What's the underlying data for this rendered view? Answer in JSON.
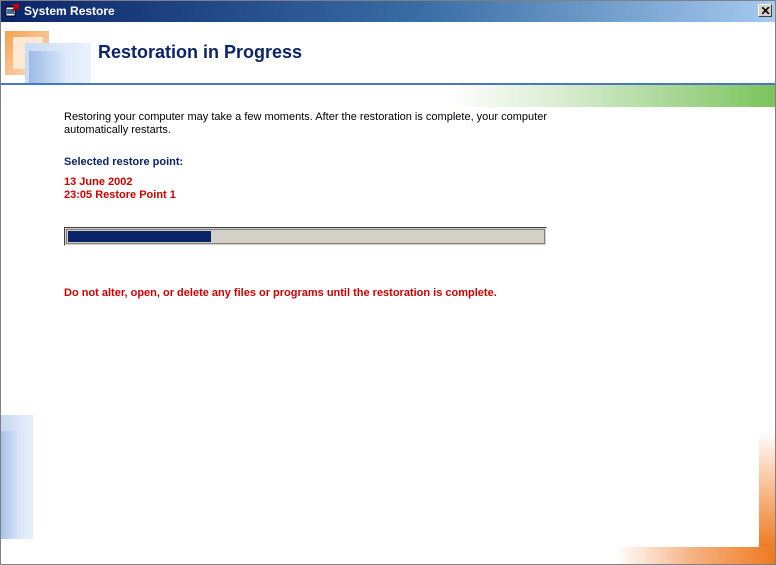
{
  "window": {
    "title": "System Restore",
    "icons": {
      "app": "system-restore-icon",
      "close": "close-icon"
    }
  },
  "header": {
    "title": "Restoration in Progress",
    "colors": {
      "title": "#0a246a",
      "rule": "#4a78c0",
      "accent_strip": "#7bc45c"
    }
  },
  "body": {
    "intro": "Restoring your computer may take a few moments. After the restoration is complete, your computer automatically restarts.",
    "selected_label": "Selected restore point:",
    "restore_point_date": "13 June 2002",
    "restore_point_name": "23:05 Restore Point 1",
    "progress_fraction": 0.3,
    "warning": "Do not alter, open, or delete any files or programs until the restoration is complete.",
    "colors": {
      "label": "#0a246a",
      "restore_point": "#d40000",
      "warning": "#d40000",
      "progress_fill": "#0a246a"
    }
  }
}
